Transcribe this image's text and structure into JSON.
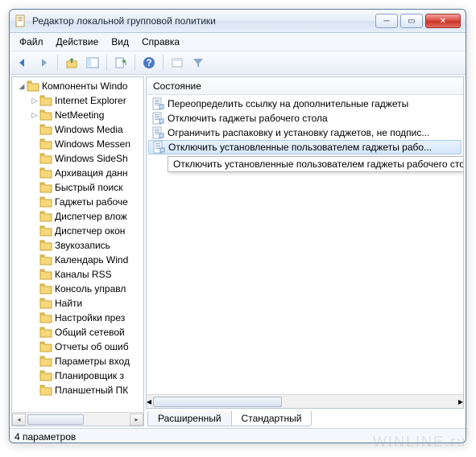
{
  "window": {
    "title": "Редактор локальной групповой политики"
  },
  "menu": {
    "file": "Файл",
    "action": "Действие",
    "view": "Вид",
    "help": "Справка"
  },
  "tree": {
    "root": "Компоненты Windo",
    "items": [
      "Internet Explorer",
      "NetMeeting",
      "Windows Media",
      "Windows Messen",
      "Windows SideSh",
      "Архивация данн",
      "Быстрый поиск",
      "Гаджеты рабоче",
      "Диспетчер влож",
      "Диспетчер окон",
      "Звукозапись",
      "Календарь Wind",
      "Каналы RSS",
      "Консоль управл",
      "Найти",
      "Настройки през",
      "Общий сетевой",
      "Отчеты об ошиб",
      "Параметры вход",
      "Планировщик з",
      "Планшетный ПК"
    ]
  },
  "list": {
    "header": "Состояние",
    "rows": [
      "Переопределить ссылку на дополнительные гаджеты",
      "Отключить гаджеты рабочего стола",
      "Ограничить распаковку и установку гаджетов, не подпис...",
      "Отключить установленные пользователем гаджеты рабо..."
    ],
    "tooltip": "Отключить установленные пользователем гаджеты рабочего стола"
  },
  "tabs": {
    "extended": "Расширенный",
    "standard": "Стандартный"
  },
  "status": "4 параметров",
  "watermark": "WINLINE.ru"
}
